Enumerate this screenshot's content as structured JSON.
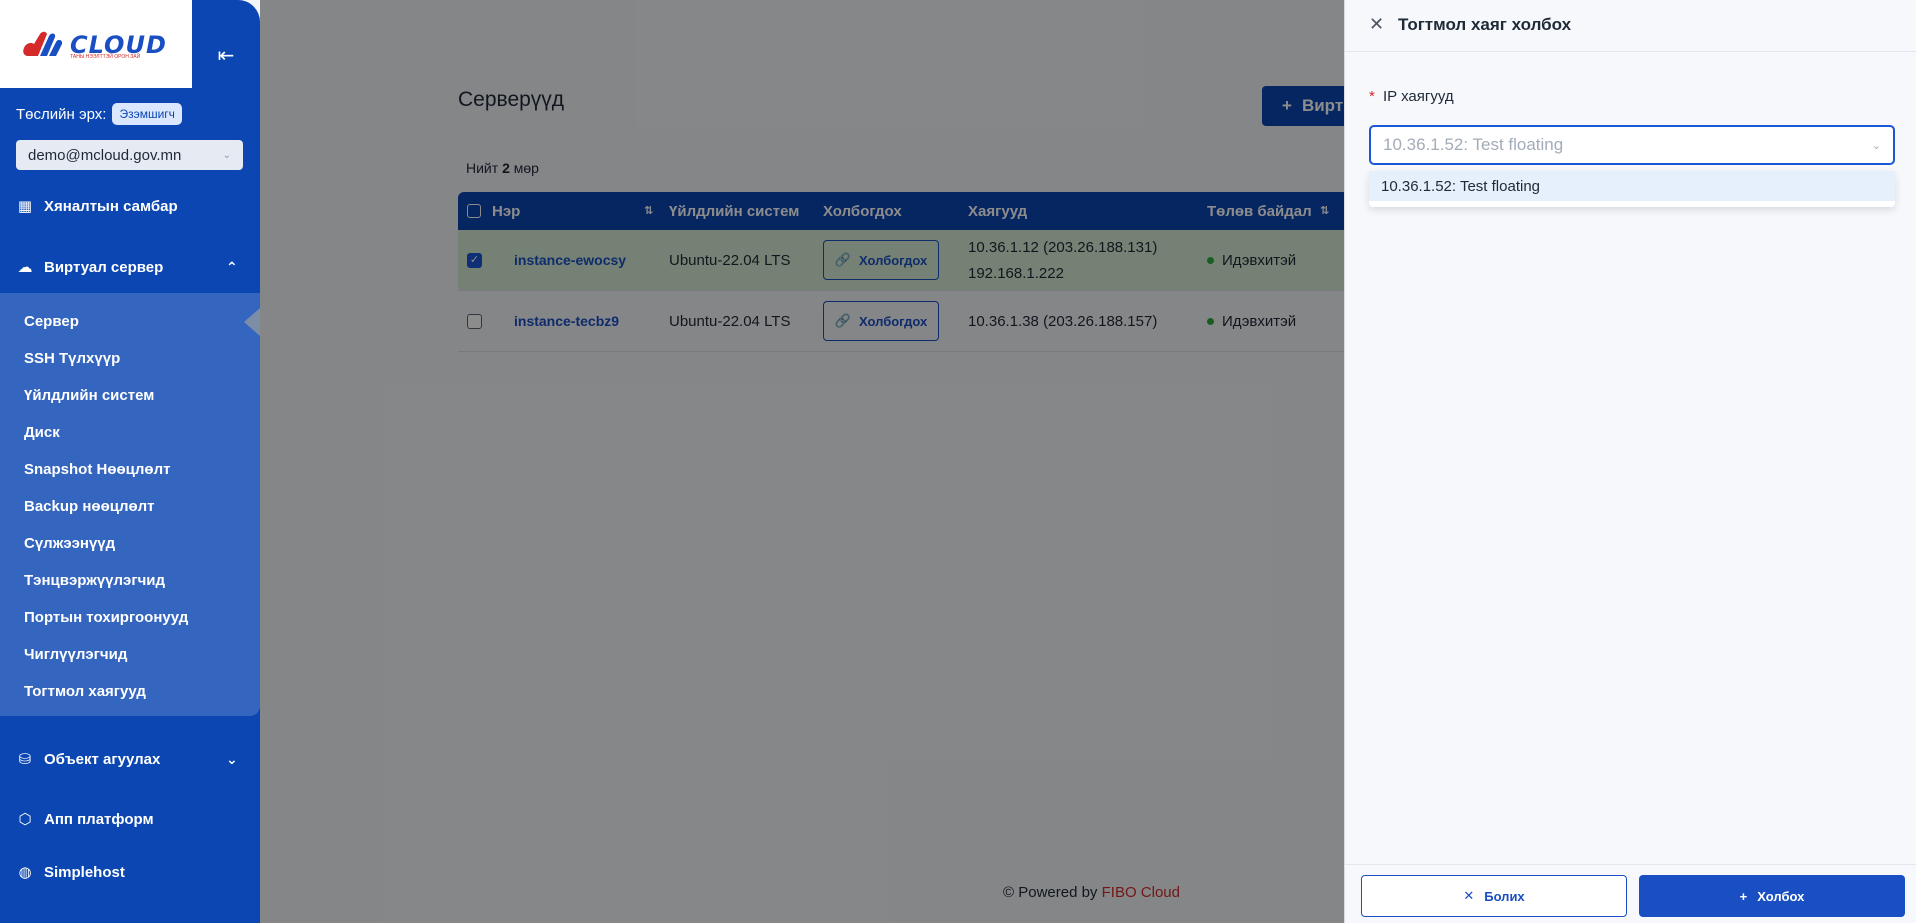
{
  "sidebar": {
    "logo_text": "CLOUD",
    "logo_subtext": "ТАНЫ НЭЭЛТТЭЙ ОРОН ЗАЙ",
    "role_label": "Төслийн эрх:",
    "role_badge": "Эзэмшигч",
    "account_email": "demo@mcloud.gov.mn",
    "nav": {
      "dashboard": "Хяналтын самбар",
      "virtual_server": "Виртуал сервер",
      "object_storage": "Объект агуулах",
      "app_platform": "Апп платформ",
      "simplehost": "Simplehost"
    },
    "submenu": [
      "Сервер",
      "SSH Түлхүүр",
      "Үйлдлийн систем",
      "Диск",
      "Snapshot Нөөцлөлт",
      "Backup нөөцлөлт",
      "Сүлжээнүүд",
      "Тэнцвэржүүлэгчид",
      "Портын тохиргоонууд",
      "Чиглүүлэгчид",
      "Тогтмол хаягууд"
    ]
  },
  "main": {
    "title": "Серверүүд",
    "create_button": "Вирт",
    "total_prefix": "Нийт",
    "total_count": "2",
    "total_suffix": "мөр",
    "columns": {
      "name": "Нэр",
      "os": "Үйлдлийн систем",
      "connect": "Холбогдох",
      "addresses": "Хаягууд",
      "status": "Төлөв байдал"
    },
    "rows": [
      {
        "name": "instance-ewocsy",
        "os": "Ubuntu-22.04 LTS",
        "connect": "Холбогдох",
        "address1": "10.36.1.12 (203.26.188.131)",
        "address2": "192.168.1.222",
        "status": "Идэвхитэй"
      },
      {
        "name": "instance-tecbz9",
        "os": "Ubuntu-22.04 LTS",
        "connect": "Холбогдох",
        "address1": "10.36.1.38 (203.26.188.157)",
        "status": "Идэвхитэй"
      }
    ],
    "footer_prefix": "© Powered by",
    "footer_brand": "FIBO Cloud"
  },
  "drawer": {
    "title": "Тогтмол хаяг холбох",
    "field_label": "IP хаягууд",
    "select_value": "10.36.1.52: Test floating",
    "options": [
      "10.36.1.52: Test floating"
    ],
    "cancel": "Болих",
    "connect": "Холбох"
  },
  "colors": {
    "primary": "#0b46b2",
    "accent": "#1a4fc4",
    "status_active": "#2faa3b",
    "brand_red": "#d42a2a"
  }
}
